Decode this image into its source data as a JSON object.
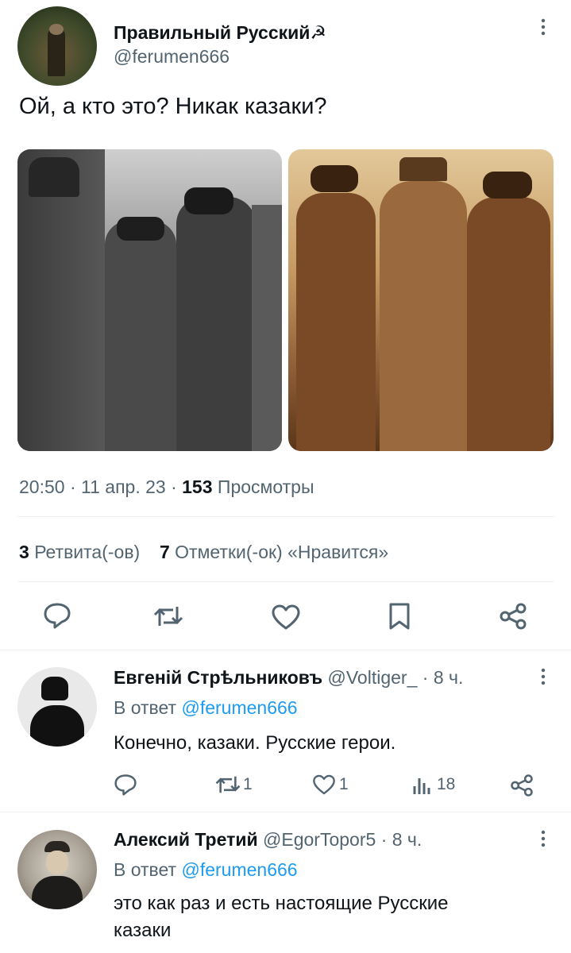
{
  "tweet": {
    "author_name": "Правильный Русский☭",
    "author_handle": "@ferumen666",
    "text": "Ой, а кто это? Никак казаки?",
    "time": "20:50",
    "dot1": "·",
    "date": "11 апр. 23",
    "dot2": "·",
    "views_count": "153",
    "views_label": "Просмотры",
    "retweets_count": "3",
    "retweets_label": "Ретвита(-ов)",
    "likes_count": "7",
    "likes_label": "Отметки(-ок) «Нравится»"
  },
  "replies": [
    {
      "author_name": "Евгенiй Стрѣльниковъ",
      "author_handle": "@Voltiger_",
      "sep": "·",
      "time": "8 ч.",
      "reply_prefix": "В ответ",
      "reply_to": "@ferumen666",
      "text": "Конечно, казаки. Русские герои.",
      "retweets": "1",
      "likes": "1",
      "views": "18"
    },
    {
      "author_name": "Алексий Третий",
      "author_handle": "@EgorTopor5",
      "sep": "·",
      "time": "8 ч.",
      "reply_prefix": "В ответ",
      "reply_to": "@ferumen666",
      "text_line1": "это как раз и есть настоящие Русские",
      "text_line2": "казаки"
    }
  ],
  "icons": {
    "more": "more-vertical-icon",
    "reply": "reply-icon",
    "retweet": "retweet-icon",
    "like": "heart-icon",
    "bookmark": "bookmark-icon",
    "share": "share-icon",
    "views": "views-bar-icon"
  },
  "colors": {
    "text": "#0f1419",
    "muted": "#536471",
    "link": "#1d9bf0",
    "divider": "#eff3f4"
  }
}
